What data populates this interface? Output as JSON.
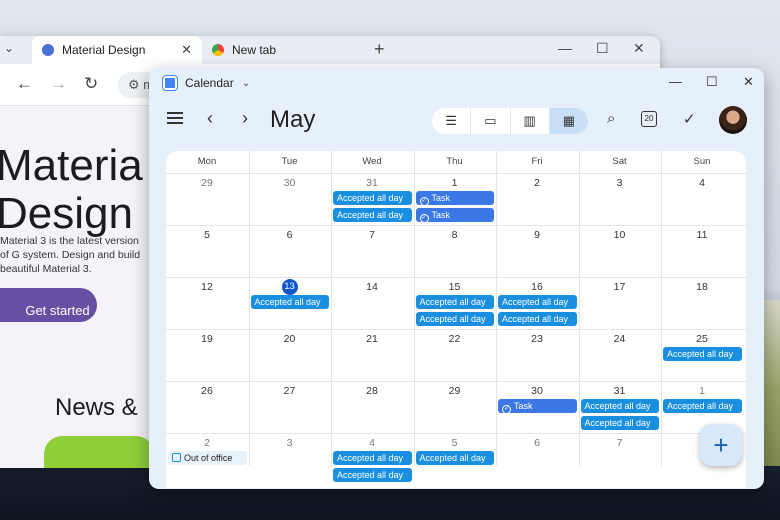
{
  "browser": {
    "tabs": [
      {
        "label": "Material Design",
        "active": true
      },
      {
        "label": "New tab",
        "active": false
      }
    ],
    "address_text": "m",
    "page": {
      "title": "Material Design",
      "title_line1": "Materia",
      "title_line2": "Design",
      "description": "Material 3 is the latest version of G system. Design and build beautiful Material 3.",
      "cta": "Get started",
      "section_heading": "News &"
    }
  },
  "calendar": {
    "window_title": "Calendar",
    "month": "May",
    "date_icon_number": "20",
    "weekdays": [
      "Mon",
      "Tue",
      "Wed",
      "Thu",
      "Fri",
      "Sat",
      "Sun"
    ],
    "weeks": [
      [
        "29",
        "30",
        "31",
        "1",
        "2",
        "3",
        "4"
      ],
      [
        "5",
        "6",
        "7",
        "8",
        "9",
        "10",
        "11"
      ],
      [
        "12",
        "13",
        "14",
        "15",
        "16",
        "17",
        "18"
      ],
      [
        "19",
        "20",
        "21",
        "22",
        "23",
        "24",
        "25"
      ],
      [
        "26",
        "27",
        "28",
        "29",
        "30",
        "31",
        "1"
      ],
      [
        "2",
        "3",
        "4",
        "5",
        "6",
        "7",
        ""
      ]
    ],
    "today": "13",
    "events": {
      "accepted": "Accepted all day",
      "task": "Task",
      "out_of_office": "Out of office"
    },
    "colors": {
      "event": "#1a8fe0",
      "task": "#3b78e6",
      "today": "#0b57d0",
      "view_selected": "#c7e0f6"
    }
  }
}
